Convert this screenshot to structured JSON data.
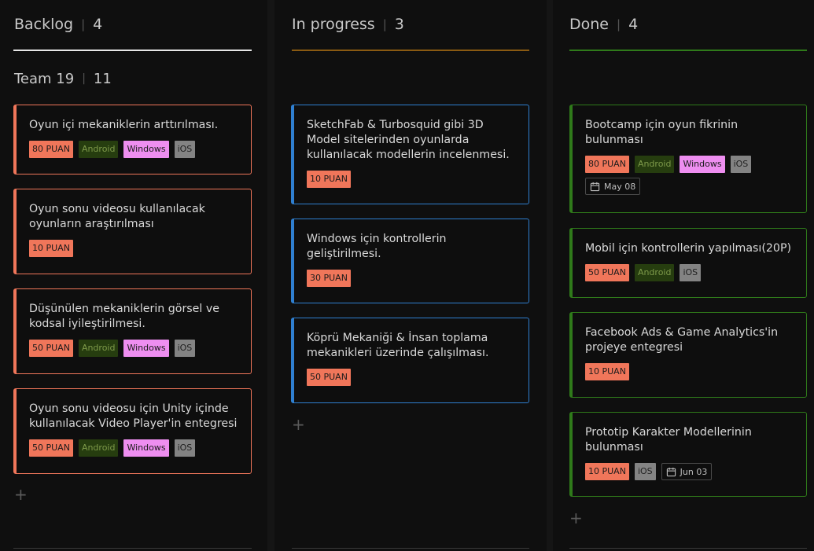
{
  "columns": {
    "backlog": {
      "title": "Backlog",
      "count": "4",
      "accent": "#e6e6e6",
      "group": {
        "title": "Team 19",
        "count": "11"
      },
      "cards": [
        {
          "title": "Oyun içi mekaniklerin arttırılması.",
          "tags": [
            "80 PUAN",
            "Android",
            "Windows",
            "iOS"
          ]
        },
        {
          "title": "Oyun sonu videosu kullanılacak oyunların araştırılması",
          "tags": [
            "10 PUAN"
          ]
        },
        {
          "title": "Düşünülen mekaniklerin görsel ve kodsal iyileştirilmesi.",
          "tags": [
            "50 PUAN",
            "Android",
            "Windows",
            "iOS"
          ]
        },
        {
          "title": "Oyun sonu videosu için Unity içinde kullanılacak Video Player'in entegresi",
          "tags": [
            "50 PUAN",
            "Android",
            "Windows",
            "iOS"
          ]
        }
      ],
      "add_icon": "+"
    },
    "progress": {
      "title": "In progress",
      "count": "3",
      "accent": "#8a5a12",
      "cards": [
        {
          "title": "SketchFab & Turbosquid gibi 3D Model sitelerinden oyunlarda kullanılacak modellerin incelenmesi.",
          "tags": [
            "10 PUAN"
          ]
        },
        {
          "title": "Windows için kontrollerin geliştirilmesi.",
          "tags": [
            "30 PUAN"
          ]
        },
        {
          "title": "Köprü Mekaniği & İnsan toplama mekanikleri üzerinde çalışılması.",
          "tags": [
            "50 PUAN"
          ]
        }
      ],
      "add_icon": "+"
    },
    "done": {
      "title": "Done",
      "count": "4",
      "accent": "#2f7a1a",
      "cards": [
        {
          "title": "Bootcamp için oyun fikrinin bulunması",
          "tags": [
            "80 PUAN",
            "Android",
            "Windows",
            "iOS"
          ],
          "date": "May 08"
        },
        {
          "title": "Mobil için kontrollerin yapılması(20P)",
          "tags": [
            "50 PUAN",
            "Android",
            "iOS"
          ]
        },
        {
          "title": "Facebook Ads & Game Analytics'in projeye entegresi",
          "tags": [
            "10 PUAN"
          ]
        },
        {
          "title": "Prototip Karakter Modellerinin bulunması",
          "tags": [
            "10 PUAN",
            "iOS"
          ],
          "date": "Jun 03"
        }
      ],
      "add_icon": "+"
    }
  },
  "colors": {
    "backlog_card_border": "#f0765a",
    "progress_card_border": "#2f7fd0",
    "done_card_border": "#2f7a1a"
  },
  "icons": {
    "date": "calendar-icon",
    "add": "plus-icon"
  }
}
